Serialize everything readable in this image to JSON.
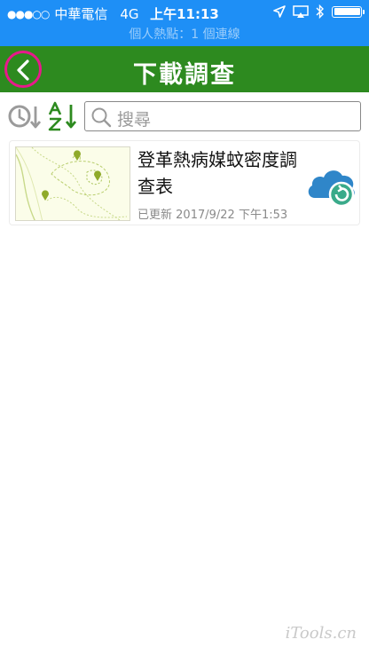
{
  "status_bar": {
    "signal": "●●●○○",
    "carrier": "中華電信",
    "network": "4G",
    "time": "上午11:13",
    "hotspot": "個人熱點：1 個連線"
  },
  "header": {
    "title": "下載調查"
  },
  "toolbar": {
    "search_placeholder": "搜尋"
  },
  "surveys": [
    {
      "title": "登革熱病媒蚊密度調查表",
      "updated_label": "已更新",
      "updated_time": "2017/9/22 下午1:53",
      "sync_icon": "cloud-sync-icon"
    }
  ],
  "watermark": "iTools.cn",
  "colors": {
    "status_bar": "#1e8ff6",
    "header": "#2d8a1f",
    "back_highlight": "#e8198b",
    "cloud": "#2f86c9",
    "sync_badge": "#3aaa8a"
  }
}
